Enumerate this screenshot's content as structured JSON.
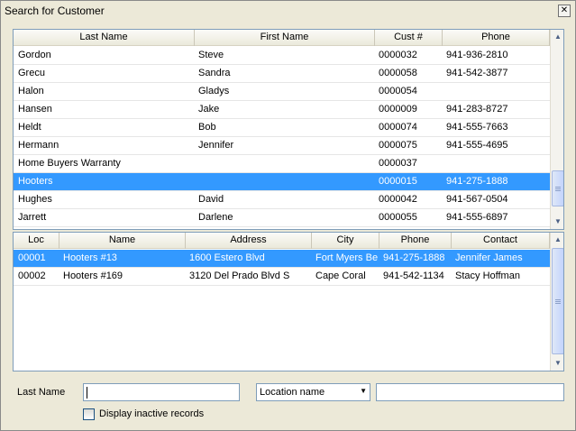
{
  "window": {
    "title": "Search for Customer",
    "close_glyph": "✕"
  },
  "customers": {
    "columns": [
      "Last Name",
      "First Name",
      "Cust #",
      "Phone"
    ],
    "rows": [
      {
        "last": "Gordon",
        "first": "Steve",
        "cust": "0000032",
        "phone": "941-936-2810",
        "selected": false
      },
      {
        "last": "Grecu",
        "first": "Sandra",
        "cust": "0000058",
        "phone": "941-542-3877",
        "selected": false
      },
      {
        "last": "Halon",
        "first": "Gladys",
        "cust": "0000054",
        "phone": "",
        "selected": false
      },
      {
        "last": "Hansen",
        "first": "Jake",
        "cust": "0000009",
        "phone": "941-283-8727",
        "selected": false
      },
      {
        "last": "Heldt",
        "first": "Bob",
        "cust": "0000074",
        "phone": "941-555-7663",
        "selected": false
      },
      {
        "last": "Hermann",
        "first": "Jennifer",
        "cust": "0000075",
        "phone": "941-555-4695",
        "selected": false
      },
      {
        "last": "Home Buyers Warranty",
        "first": "",
        "cust": "0000037",
        "phone": "",
        "selected": false
      },
      {
        "last": "Hooters",
        "first": "",
        "cust": "0000015",
        "phone": "941-275-1888",
        "selected": true
      },
      {
        "last": "Hughes",
        "first": "David",
        "cust": "0000042",
        "phone": "941-567-0504",
        "selected": false
      },
      {
        "last": "Jarrett",
        "first": "Darlene",
        "cust": "0000055",
        "phone": "941-555-6897",
        "selected": false
      }
    ]
  },
  "locations": {
    "columns": [
      "Loc",
      "Name",
      "Address",
      "City",
      "Phone",
      "Contact"
    ],
    "rows": [
      {
        "loc": "00001",
        "name": "Hooters #13",
        "address": "1600 Estero Blvd",
        "city": "Fort Myers Be",
        "phone": "941-275-1888",
        "contact": "Jennifer James",
        "selected": true
      },
      {
        "loc": "00002",
        "name": "Hooters #169",
        "address": "3120 Del Prado Blvd S",
        "city": "Cape Coral",
        "phone": "941-542-1134",
        "contact": "Stacy Hoffman",
        "selected": false
      }
    ]
  },
  "search": {
    "last_name_label": "Last Name",
    "last_name_value": "",
    "location_select_value": "Location name",
    "location_text_value": "",
    "inactive_label": "Display inactive records",
    "inactive_checked": false
  },
  "icons": {
    "scroll_up": "▲",
    "scroll_down": "▼",
    "dropdown": "▼"
  }
}
